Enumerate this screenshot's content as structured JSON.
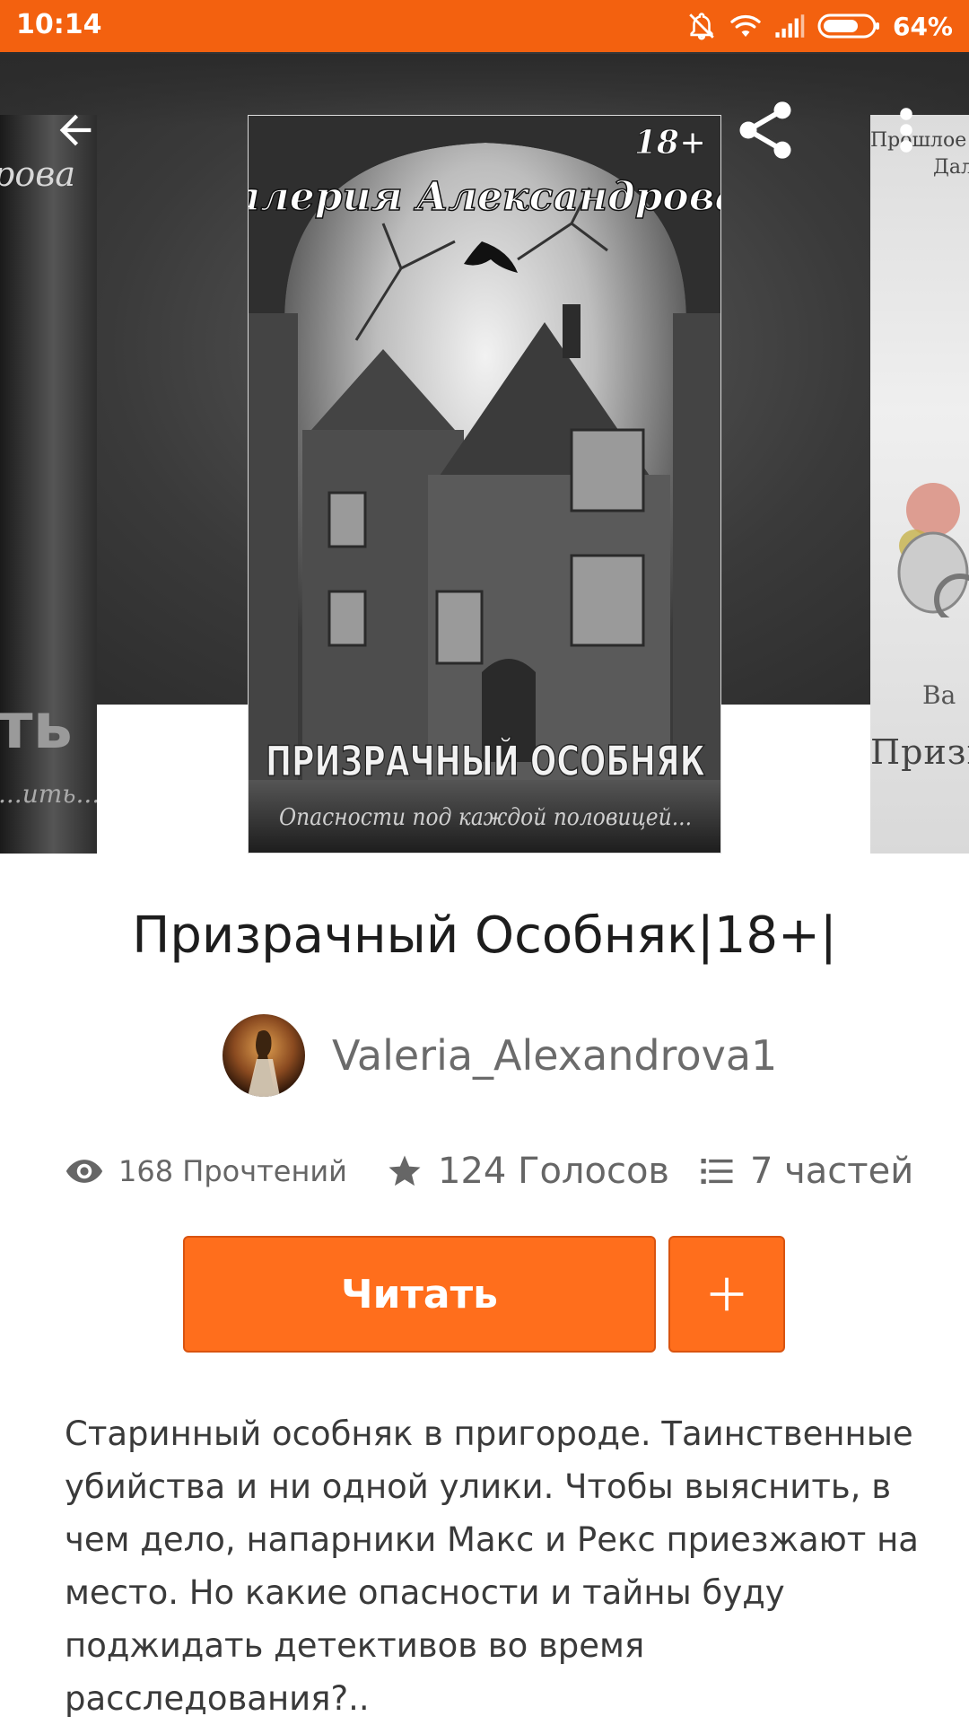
{
  "status_bar": {
    "time": "10:14",
    "battery": "64%",
    "icons": [
      "bell-off-icon",
      "wifi-icon",
      "signal-icon",
      "battery-icon"
    ],
    "color": "#f3610f"
  },
  "header": {
    "back_icon": "arrow-left-icon",
    "share_icon": "share-icon",
    "more_icon": "more-vertical-icon"
  },
  "cover": {
    "author_script": "Валерия Александрова",
    "age_badge": "18+",
    "title": "ПРИЗРАЧНЫЙ ОСОБНЯК",
    "tagline": "Опасности под каждой половицей..."
  },
  "side_covers": {
    "left": {
      "text_top": "рова",
      "text_big": "ть",
      "text_bottom": "...ить..."
    },
    "right": {
      "text_top": "Прошлое",
      "text_top2": "Дал",
      "text_mid": "Ва",
      "text_bottom": "Призн"
    }
  },
  "story": {
    "title": "Призрачный Особняк|18+|",
    "author": "Valeria_Alexandrova1",
    "reads": "168 Прочтений",
    "votes": "124 Голосов",
    "parts": "7 частей",
    "description": "Старинный особняк в пригороде. Таинственные убийства и ни одной улики. Чтобы выяснить, в чем дело, напарники Макс и Рекс приезжают на место. Но какие опасности и тайны буду поджидать детективов во время расследования?.."
  },
  "actions": {
    "read_label": "Читать",
    "add_icon": "plus-icon",
    "accent": "#ff6e1c"
  }
}
